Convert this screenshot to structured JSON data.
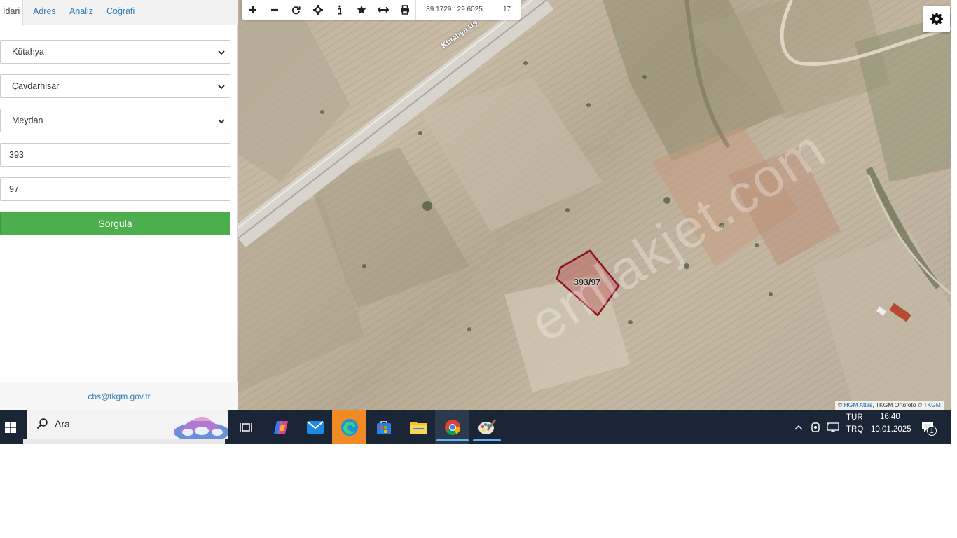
{
  "tabs": [
    {
      "label": "İdari",
      "active": true
    },
    {
      "label": "Adres"
    },
    {
      "label": "Analiz"
    },
    {
      "label": "Coğrafi"
    }
  ],
  "form": {
    "province": "Kütahya",
    "district": "Çavdarhisar",
    "neighborhood": "Meydan",
    "block": "393",
    "parcel": "97",
    "submit_label": "Sorgula"
  },
  "footer": {
    "email": "cbs@tkgm.gov.tr"
  },
  "map": {
    "coordinates": "39.1729 : 29.6025",
    "zoom": "17",
    "parcel_label": "393/97",
    "road_label": "Kütahya Uş",
    "watermark": "emlakjet.com",
    "attribution": {
      "prefix": "©",
      "link1": "HGM Atlas",
      "middle": ", TKGM Ortofoto ©",
      "link2": "TKGM"
    }
  },
  "toolbar_icons": [
    "zoom-in-icon",
    "zoom-out-icon",
    "refresh-icon",
    "locate-icon",
    "info-icon",
    "favorite-icon",
    "measure-icon",
    "print-icon"
  ],
  "taskbar": {
    "search_placeholder": "Ara",
    "language": {
      "top": "TUR",
      "bottom": "TRQ"
    },
    "clock": {
      "time": "16:40",
      "date": "10.01.2025"
    },
    "notification_count": "1"
  },
  "colors": {
    "accent_link": "#337ab7",
    "submit_green": "#4cae4c",
    "parcel_stroke": "#8b1020",
    "taskbar_bg": "#1a2535"
  }
}
